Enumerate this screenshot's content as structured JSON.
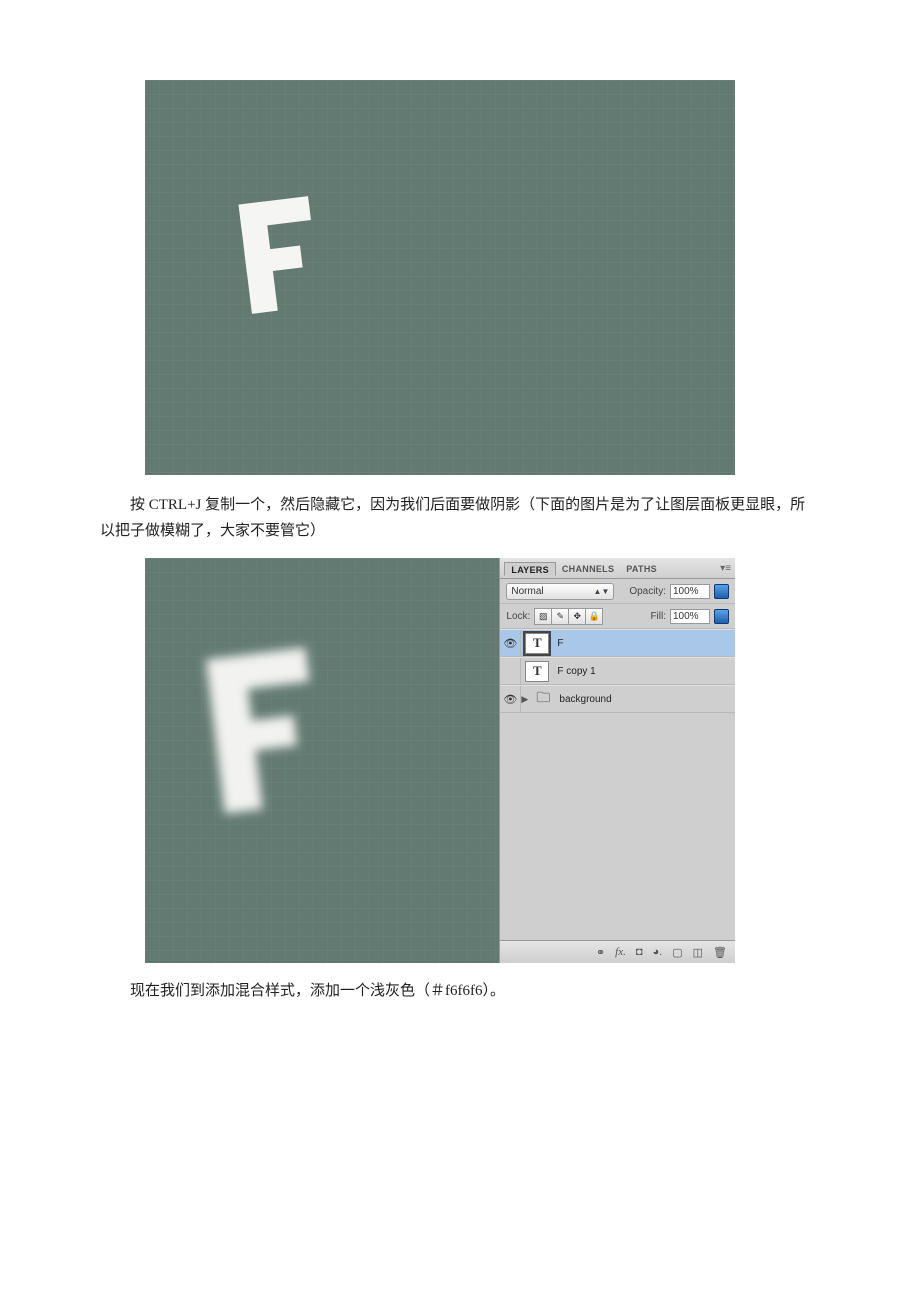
{
  "paragraph1": "按 CTRL+J 复制一个，然后隐藏它，因为我们后面要做阴影（下面的图片是为了让图层面板更显眼，所以把子做模糊了，大家不要管它）",
  "paragraph2": "现在我们到添加混合样式，添加一个浅灰色（＃f6f6f6）。",
  "panel": {
    "tabs": {
      "layers": "LAYERS",
      "channels": "CHANNELS",
      "paths": "PATHS"
    },
    "blendMode": "Normal",
    "opacityLabel": "Opacity:",
    "opacityValue": "100%",
    "lockLabel": "Lock:",
    "fillLabel": "Fill:",
    "fillValue": "100%",
    "layers": [
      {
        "thumb": "T",
        "name": "F",
        "visible": true,
        "selected": true
      },
      {
        "thumb": "T",
        "name": "F copy 1",
        "visible": false,
        "selected": false
      },
      {
        "thumb": "folder",
        "name": "background",
        "visible": true,
        "selected": false
      }
    ],
    "bottomIcons": {
      "link": "⚭",
      "fx": "fx.",
      "mask": "◘",
      "adj": "◕.",
      "folder": "▢",
      "new": "◫",
      "trash": "🗑"
    }
  }
}
